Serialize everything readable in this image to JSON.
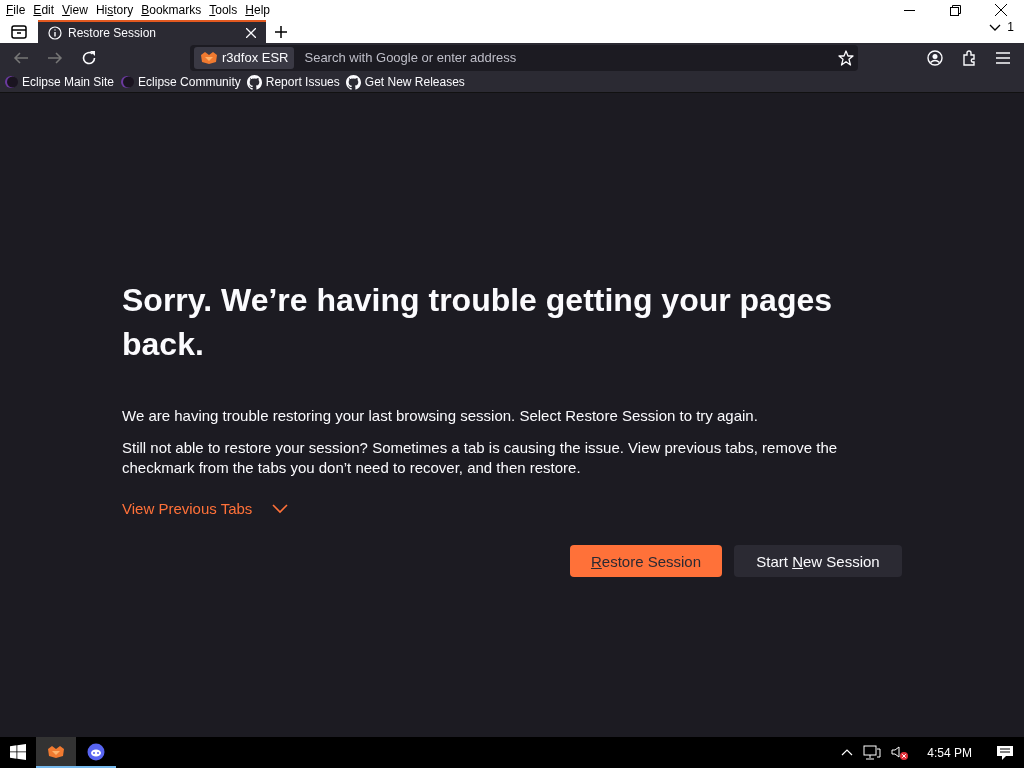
{
  "menu_bar": [
    {
      "key": "F",
      "post": "ile"
    },
    {
      "key": "E",
      "post": "dit"
    },
    {
      "key": "V",
      "post": "iew"
    },
    {
      "pre": "Hi",
      "key": "s",
      "post": "tory"
    },
    {
      "key": "B",
      "post": "ookmarks"
    },
    {
      "key": "T",
      "post": "ools"
    },
    {
      "key": "H",
      "post": "elp"
    }
  ],
  "tabs": [
    {
      "label": "Restore Session",
      "selected": true
    }
  ],
  "tab_count": "1",
  "address_bar": {
    "identity": "r3dfox ESR",
    "placeholder": "Search with Google or enter address"
  },
  "bookmarks": [
    {
      "label": "Eclipse Main Site",
      "kind": "eclipse"
    },
    {
      "label": "Eclipse Community",
      "kind": "eclipse"
    },
    {
      "label": "Report Issues",
      "kind": "github"
    },
    {
      "label": "Get New Releases",
      "kind": "github"
    }
  ],
  "content": {
    "title": "Sorry. We’re having trouble getting your pages back.",
    "paragraphs": [
      "We are having trouble restoring your last browsing session. Select Restore Session to try again.",
      "Still not able to restore your session? Sometimes a tab is causing the issue. View previous tabs, remove the checkmark from the tabs you don’t need to recover, and then restore."
    ],
    "toggle": {
      "label": "View Previous Tabs",
      "expanded": false
    },
    "buttons": [
      {
        "key": "R",
        "post": "estore Session",
        "kind": "primary"
      },
      {
        "pre": "Start ",
        "key": "N",
        "post": "ew Session",
        "kind": "secondary"
      }
    ]
  },
  "taskbar": {
    "apps": [
      {
        "kind": "browser",
        "selected": true
      },
      {
        "kind": "chat",
        "selected": false
      }
    ],
    "clock": "4:54 PM"
  }
}
